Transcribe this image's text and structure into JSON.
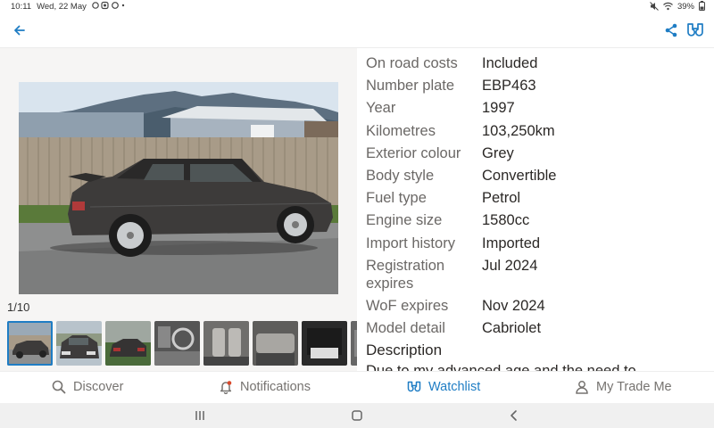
{
  "status_bar": {
    "time": "10:11",
    "date": "Wed, 22 May",
    "battery": "39%"
  },
  "app_bar": {
    "icons": [
      "back-arrow-icon",
      "share-icon",
      "watchlist-binoculars-icon"
    ]
  },
  "gallery": {
    "counter": "1/10",
    "thumbnail_count": 8,
    "selected_index": 0
  },
  "details": [
    {
      "label": "On road costs",
      "value": "Included"
    },
    {
      "label": "Number plate",
      "value": "EBP463"
    },
    {
      "label": "Year",
      "value": "1997"
    },
    {
      "label": "Kilometres",
      "value": "103,250km"
    },
    {
      "label": "Exterior colour",
      "value": "Grey"
    },
    {
      "label": "Body style",
      "value": "Convertible"
    },
    {
      "label": "Fuel type",
      "value": "Petrol"
    },
    {
      "label": "Engine size",
      "value": "1580cc"
    },
    {
      "label": "Import history",
      "value": "Imported"
    },
    {
      "label": "Registration expires",
      "value": "Jul 2024"
    },
    {
      "label": "WoF expires",
      "value": "Nov 2024"
    },
    {
      "label": "Model detail",
      "value": "Cabriolet"
    }
  ],
  "description": {
    "heading": "Description",
    "text": "Due to my advanced age and the need to"
  },
  "bottom_nav": [
    {
      "label": "Discover",
      "icon": "search-icon",
      "active": false
    },
    {
      "label": "Notifications",
      "icon": "bell-icon",
      "active": false
    },
    {
      "label": "Watchlist",
      "icon": "binoculars-icon",
      "active": true
    },
    {
      "label": "My Trade Me",
      "icon": "person-icon",
      "active": false
    }
  ],
  "colors": {
    "accent": "#1f7dc4",
    "label": "#6b6866",
    "value": "#2b2826"
  }
}
